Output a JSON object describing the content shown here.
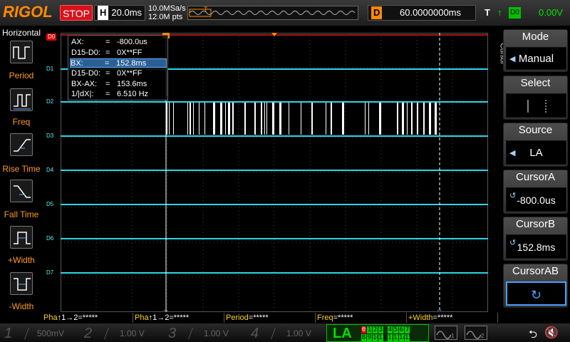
{
  "top": {
    "brand": "RIGOL",
    "run_state": "STOP",
    "h_label": "H",
    "timebase": "20.0ms",
    "sample_rate": "10.0MSa/s",
    "memory_depth": "12.0M pts",
    "trigger_marker": "T",
    "delay_label": "D",
    "delay_value": "60.0000000ms",
    "trigger_label": "T",
    "trigger_edge_icon": "rising-edge-icon",
    "trigger_source": "D0",
    "trigger_level": "0.00V"
  },
  "left_panel": {
    "title": "Horizontal",
    "buttons": [
      {
        "label": "Period",
        "icon": "period-measure-icon"
      },
      {
        "label": "Freq",
        "icon": "frequency-measure-icon"
      },
      {
        "label": "Rise Time",
        "icon": "rise-time-icon"
      },
      {
        "label": "Fall Time",
        "icon": "fall-time-icon"
      },
      {
        "label": "+Width",
        "icon": "positive-width-icon"
      },
      {
        "label": "-Width",
        "icon": "negative-width-icon"
      }
    ]
  },
  "channels": [
    "D0",
    "D1",
    "D2",
    "D3",
    "D4",
    "D5",
    "D6",
    "D7"
  ],
  "cursor_readout": [
    {
      "key": "AX:",
      "eq": "=",
      "value": "-800.0us"
    },
    {
      "key": "D15-D0:",
      "eq": "=",
      "value": "0X**FF"
    },
    {
      "key": "BX:",
      "eq": "=",
      "value": "152.8ms"
    },
    {
      "key": "D15-D0:",
      "eq": "=",
      "value": "0X**FF"
    },
    {
      "key": "BX-AX:",
      "eq": "=",
      "value": "153.6ms"
    },
    {
      "key": "1/|dX|:",
      "eq": "=",
      "value": "6.510 Hz"
    }
  ],
  "measurements": [
    {
      "label": "Pha",
      "mid": "↑1→2",
      "value": "=*****"
    },
    {
      "label": "Pha",
      "mid": "↑1→2",
      "value": "=*****"
    },
    {
      "label": "Period",
      "mid": "",
      "value": "=*****"
    },
    {
      "label": "Freq",
      "mid": "",
      "value": "=*****"
    },
    {
      "label": "+Width",
      "mid": "",
      "value": "=*****"
    }
  ],
  "right_menu": {
    "vertical_label": "Cursor",
    "mode_title": "Mode",
    "mode_value": "Manual",
    "select_title": "Select",
    "source_title": "Source",
    "source_value": "LA",
    "cursora_title": "CursorA",
    "cursora_value": "-800.0us",
    "cursorb_title": "CursorB",
    "cursorb_value": "152.8ms",
    "cursorab_title": "CursorAB",
    "cursorab_icon": "cycle-arrow-icon"
  },
  "status_bar": {
    "ch1_num": "1",
    "ch1_scale": "500mV",
    "ch2_num": "2",
    "ch2_scale": "1.00 V",
    "ch3_num": "3",
    "ch3_scale": "1.00 V",
    "ch4_num": "4",
    "ch4_scale": "1.00 V",
    "la_label": "LA",
    "la_bits_top": [
      "0",
      "1",
      "2",
      "3",
      "4",
      "5",
      "6",
      "7"
    ],
    "la_bits_bottom": [
      "8",
      "9",
      "10",
      "11",
      "12",
      "13",
      "14",
      "15"
    ],
    "usb_icon": "usb-icon",
    "speaker_icon": "speaker-muted-icon"
  },
  "colors": {
    "brand": "#ff8a00",
    "stop": "#d8111c",
    "trace": "#2ad6e6",
    "trigger": "#00e600",
    "label_orange": "#ff9a20",
    "cursor_highlight": "#2a5f95"
  }
}
